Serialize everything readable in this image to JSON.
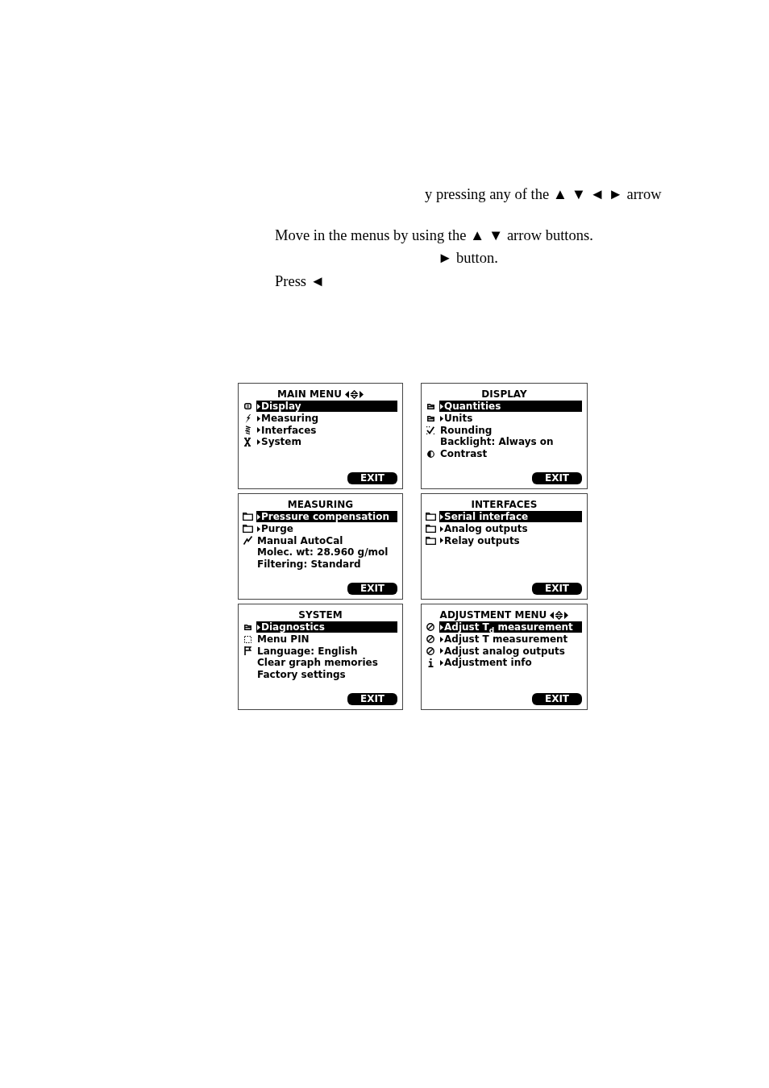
{
  "instructions": [
    {
      "text": "y pressing any of the ▲ ▼ ◄ ► arrow"
    },
    {
      "text": "Move in the menus by using the ▲ ▼ arrow buttons."
    },
    {
      "text": "► button."
    },
    {
      "text": "Press ◄"
    }
  ],
  "screens": [
    {
      "title": "MAIN MENU",
      "nav_arrows": true,
      "items": [
        {
          "kind": "monitor",
          "submenu": true,
          "label": "Display",
          "selected": true
        },
        {
          "kind": "bolt",
          "submenu": true,
          "label": "Measuring",
          "selected": false
        },
        {
          "kind": "zigzag",
          "submenu": true,
          "label": "Interfaces",
          "selected": false
        },
        {
          "kind": "tools",
          "submenu": true,
          "label": "System",
          "selected": false
        }
      ],
      "exit": "EXIT"
    },
    {
      "title": "DISPLAY",
      "nav_arrows": false,
      "items": [
        {
          "kind": "folder",
          "submenu": true,
          "label": "Quantities",
          "selected": true
        },
        {
          "kind": "folder",
          "submenu": true,
          "label": "Units",
          "selected": false
        },
        {
          "kind": "check",
          "submenu": false,
          "label": "Rounding",
          "selected": false
        },
        {
          "kind": "plain",
          "submenu": false,
          "label": "Backlight: Always on",
          "selected": false
        },
        {
          "kind": "contrast",
          "submenu": false,
          "label": "Contrast",
          "selected": false
        }
      ],
      "exit": "EXIT"
    },
    {
      "title": "MEASURING",
      "nav_arrows": false,
      "items": [
        {
          "kind": "folder-outline",
          "submenu": true,
          "label": "Pressure compensation",
          "selected": true
        },
        {
          "kind": "folder-outline",
          "submenu": true,
          "label": "Purge",
          "selected": false
        },
        {
          "kind": "slanted-bolt",
          "submenu": false,
          "label": "Manual AutoCal",
          "selected": false
        },
        {
          "kind": "plain",
          "submenu": false,
          "label": "Molec. wt: 28.960 g/mol",
          "selected": false
        },
        {
          "kind": "plain",
          "submenu": false,
          "label": "Filtering: Standard",
          "selected": false
        }
      ],
      "exit": "EXIT"
    },
    {
      "title": "INTERFACES",
      "nav_arrows": false,
      "items": [
        {
          "kind": "folder-outline",
          "submenu": true,
          "label": "Serial interface",
          "selected": true
        },
        {
          "kind": "folder-outline",
          "submenu": true,
          "label": "Analog outputs",
          "selected": false
        },
        {
          "kind": "folder-outline",
          "submenu": true,
          "label": "Relay outputs",
          "selected": false
        }
      ],
      "exit": "EXIT"
    },
    {
      "title": "SYSTEM",
      "nav_arrows": false,
      "items": [
        {
          "kind": "folder",
          "submenu": true,
          "label": "Diagnostics",
          "selected": true
        },
        {
          "kind": "dotted-square",
          "submenu": false,
          "label": "Menu PIN",
          "selected": false
        },
        {
          "kind": "flag",
          "submenu": false,
          "label": "Language: English",
          "selected": false
        },
        {
          "kind": "plain",
          "submenu": false,
          "label": "Clear graph memories",
          "selected": false
        },
        {
          "kind": "plain",
          "submenu": false,
          "label": "Factory settings",
          "selected": false
        }
      ],
      "exit": "EXIT"
    },
    {
      "title": "ADJUSTMENT MENU",
      "nav_arrows": true,
      "items": [
        {
          "kind": "circle-slash",
          "submenu": true,
          "label": "Adjust T$_{d}$ measurement",
          "selected": true
        },
        {
          "kind": "circle-slash",
          "submenu": true,
          "label": "Adjust T measurement",
          "selected": false
        },
        {
          "kind": "circle-slash",
          "submenu": true,
          "label": "Adjust analog outputs",
          "selected": false
        },
        {
          "kind": "info",
          "submenu": true,
          "label": "Adjustment info",
          "selected": false
        }
      ],
      "exit": "EXIT"
    }
  ]
}
